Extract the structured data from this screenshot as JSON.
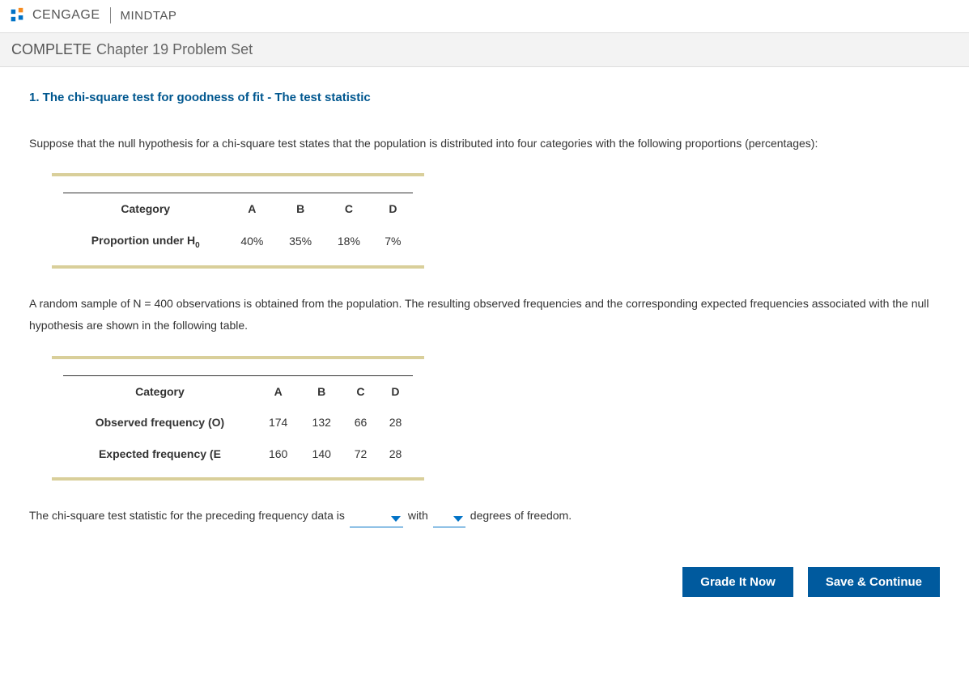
{
  "brand": {
    "main": "CENGAGE",
    "sub": "MINDTAP"
  },
  "subheader": {
    "status": "COMPLETE",
    "title": "Chapter 19 Problem Set"
  },
  "question": {
    "title": "1. The chi-square test for goodness of fit - The test statistic",
    "para1": "Suppose that the null hypothesis for a chi-square test states that the population is distributed into four categories with the following proportions (percentages):",
    "para2": "A random sample of N = 400 observations is obtained from the population. The resulting observed frequencies and the corresponding expected frequencies associated with the null hypothesis are shown in the following table.",
    "fill_pre": "The chi-square test statistic for the preceding frequency data is",
    "fill_mid": "with",
    "fill_post": "degrees of freedom."
  },
  "table1": {
    "row0": {
      "label": "Category",
      "c1": "A",
      "c2": "B",
      "c3": "C",
      "c4": "D"
    },
    "row1": {
      "label_pre": "Proportion under H",
      "label_sub": "0",
      "c1": "40%",
      "c2": "35%",
      "c3": "18%",
      "c4": "7%"
    }
  },
  "table2": {
    "row0": {
      "label": "Category",
      "c1": "A",
      "c2": "B",
      "c3": "C",
      "c4": "D"
    },
    "row1": {
      "label": "Observed frequency (O)",
      "c1": "174",
      "c2": "132",
      "c3": "66",
      "c4": "28"
    },
    "row2": {
      "label": "Expected frequency (E",
      "c1": "160",
      "c2": "140",
      "c3": "72",
      "c4": "28"
    }
  },
  "buttons": {
    "grade": "Grade It Now",
    "save": "Save & Continue"
  }
}
